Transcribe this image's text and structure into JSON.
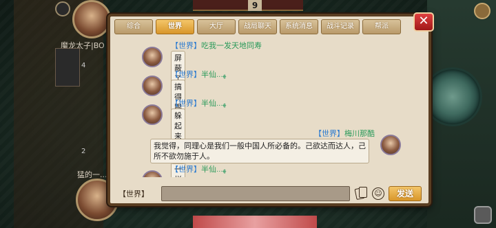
{
  "background": {
    "top_counter": "9",
    "top_player_label": "魔龙太子|BO",
    "bottom_player_label": "猛的一...",
    "side_numbers": [
      "4",
      "2"
    ]
  },
  "chat": {
    "tabs": [
      {
        "label": "综合",
        "active": false
      },
      {
        "label": "世界",
        "active": true
      },
      {
        "label": "大厅",
        "active": false
      },
      {
        "label": "战局聊天",
        "active": false
      },
      {
        "label": "系统消息",
        "active": false
      },
      {
        "label": "战斗记录",
        "active": false
      },
      {
        "label": "帮派",
        "active": false
      }
    ],
    "close_label": "✕",
    "messages": [
      {
        "side": "left",
        "channel": "【世界】",
        "sender": "吃我一发天地同寿",
        "deco": "",
        "text": "屏蔽了"
      },
      {
        "side": "left",
        "channel": "【世界】",
        "sender": "半仙",
        "deco": "...ﻬ",
        "text": "搞得跟堆地下党人一样"
      },
      {
        "side": "left",
        "channel": "【世界】",
        "sender": "半仙",
        "deco": "...ﻬ",
        "text": "躲起来吃我"
      },
      {
        "side": "right",
        "channel": "【世界】",
        "sender": "梅川那酷",
        "deco": "",
        "text": "我觉得，同理心是我们一般中国人所必备的。己欲达而达人，己所不欲勿施于人。"
      },
      {
        "side": "left",
        "channel": "【世界】",
        "sender": "半仙",
        "deco": "...ﻬ",
        "text": ""
      }
    ],
    "input": {
      "channel_label": "【世界】",
      "value": "",
      "send_label": "发送"
    }
  }
}
